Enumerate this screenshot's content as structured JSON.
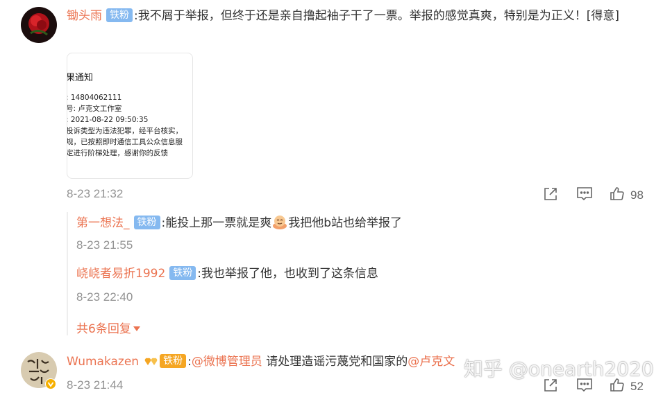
{
  "comment1": {
    "author": "锄头雨",
    "badge": "铁粉",
    "text": ":我不屑于举报，但终于还是亲自撸起袖子干了一票。举报的感觉真爽，特别是为正义！[得意]",
    "image_lines": [
      "果通知",
      ": 14804062111",
      "号: 卢克文工作室",
      ": 2021-08-22 09:50:35",
      "投诉类型为违法犯罪，经平台核实，",
      "规，已按照即时通信工具公众信息服",
      "定进行阶梯处理，感谢你的反馈"
    ],
    "time": "8-23 21:32",
    "like_count": "98"
  },
  "replies": [
    {
      "author": "第一想法_",
      "badge": "铁粉",
      "text_before": ":能投上那一票就是爽",
      "emoji": "face-emoji",
      "text_after": "我把他b站也给举报了",
      "time": "8-23 21:55"
    },
    {
      "author": "峣峣者易折1992",
      "badge": "铁粉",
      "text": ":我也举报了他，也收到了这条信息",
      "time": "8-23 22:40"
    }
  ],
  "more_replies": "共6条回复",
  "comment2": {
    "author": "Wumakazen",
    "badge": "铁粉",
    "mention1": "@微博管理员",
    "text": " 请处理造谣污蔑党和国家的",
    "mention2": "@卢克文",
    "time": "8-23 21:44",
    "like_count": "52"
  },
  "watermark": "知乎 @onearth2020",
  "colors": {
    "accent": "#eb7350",
    "badge": "#85b9f0",
    "muted": "#939393"
  }
}
